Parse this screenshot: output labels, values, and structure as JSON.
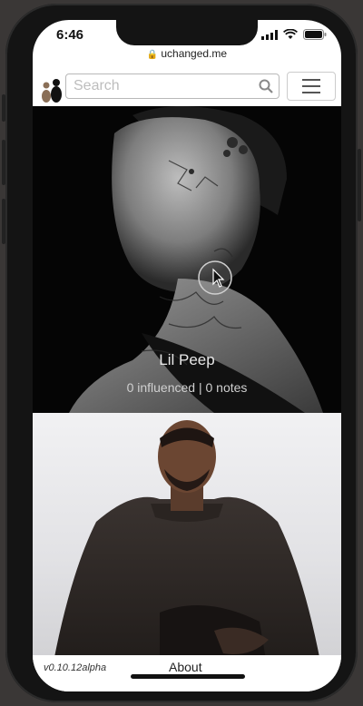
{
  "status": {
    "time": "6:46"
  },
  "browser": {
    "url": "uchanged.me"
  },
  "nav": {
    "search_placeholder": "Search"
  },
  "people": [
    {
      "name": "Lil Peep",
      "stats": "0 influenced | 0 notes"
    },
    {
      "name": "",
      "stats": ""
    }
  ],
  "footer": {
    "version": "v0.10.12alpha",
    "about": "About"
  },
  "icons": {
    "lock": "lock-icon",
    "search": "search-icon",
    "menu": "hamburger-menu-icon",
    "cursor": "pointer-cursor-icon",
    "signal": "signal-icon",
    "wifi": "wifi-icon",
    "battery": "battery-icon"
  },
  "colors": {
    "card_background": "#050505",
    "text_light": "#e6e6e6"
  }
}
